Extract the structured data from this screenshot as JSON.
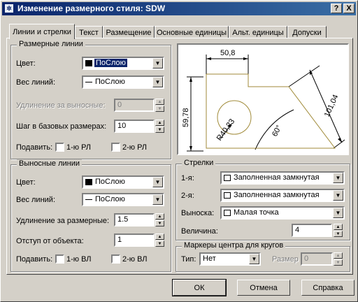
{
  "window": {
    "title": "Изменение размерного стиля: SDW",
    "help_button": "?",
    "close_button": "X"
  },
  "tabs": [
    {
      "label": "Линии и стрелки",
      "active": true
    },
    {
      "label": "Текст",
      "active": false
    },
    {
      "label": "Размещение",
      "active": false
    },
    {
      "label": "Основные единицы",
      "active": false
    },
    {
      "label": "Альт. единицы",
      "active": false
    },
    {
      "label": "Допуски",
      "active": false
    }
  ],
  "dim_lines": {
    "title": "Размерные линии",
    "color_label": "Цвет:",
    "color_value": "ПоСлою",
    "weight_label": "Вес линий:",
    "weight_value": "ПоСлою",
    "extension_label": "Удлинение за выносные:",
    "extension_value": "0",
    "baseline_label": "Шаг в базовых размерах:",
    "baseline_value": "10",
    "suppress_label": "Подавить:",
    "suppress_1": "1-ю РЛ",
    "suppress_2": "2-ю РЛ"
  },
  "ext_lines": {
    "title": "Выносные линии",
    "color_label": "Цвет:",
    "color_value": "ПоСлою",
    "weight_label": "Вес линий:",
    "weight_value": "ПоСлою",
    "extend_label": "Удлинение за размерные:",
    "extend_value": "1.5",
    "offset_label": "Отступ от объекта:",
    "offset_value": "1",
    "suppress_label": "Подавить:",
    "suppress_1": "1-ю ВЛ",
    "suppress_2": "2-ю ВЛ"
  },
  "preview": {
    "dim_top": "50,8",
    "dim_left": "59,78",
    "dim_right": "101,04",
    "dim_radius": "R40,23",
    "dim_angle": "60°"
  },
  "arrows": {
    "title": "Стрелки",
    "first_label": "1-я:",
    "first_value": "Заполненная замкнутая",
    "second_label": "2-я:",
    "second_value": "Заполненная замкнутая",
    "leader_label": "Выноска:",
    "leader_value": "Малая точка",
    "size_label": "Величина:",
    "size_value": "4"
  },
  "center": {
    "title": "Маркеры центра для кругов",
    "type_label": "Тип:",
    "type_value": "Нет",
    "size_label": "Размер",
    "size_value": "0"
  },
  "buttons": {
    "ok": "ОК",
    "cancel": "Отмена",
    "help": "Справка"
  },
  "colors": {
    "titlebar_start": "#0a246a",
    "titlebar_end": "#3a6ea5",
    "selection": "#0a246a",
    "preview_outline": "#a08a38",
    "dialog_bg": "#d4d0c8"
  }
}
